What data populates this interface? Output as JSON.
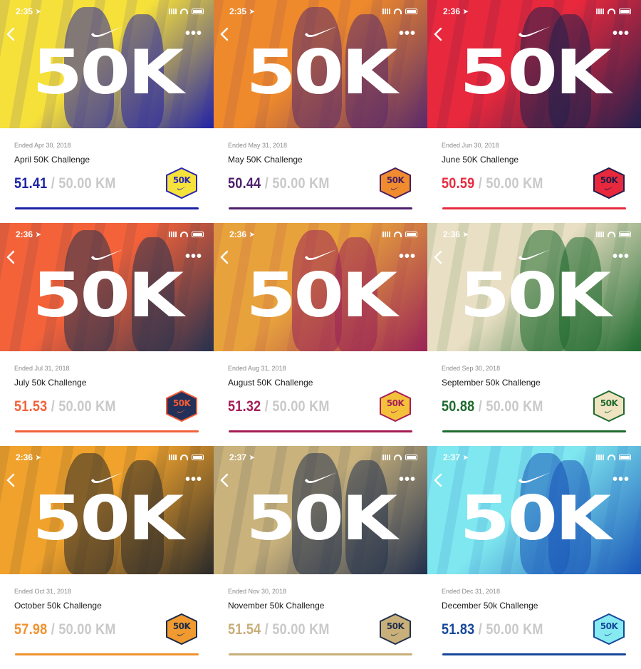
{
  "status": {
    "more_label": "•••"
  },
  "hero_title": "50K",
  "badge_text": "50K",
  "cards": [
    {
      "time": "2:35",
      "ended": "Ended Apr 30, 2018",
      "title": "April 50K Challenge",
      "distance": "51.41",
      "goal": " / 50.00 KM",
      "accent": "#1b22a3",
      "hero_color": "#f6e03a",
      "hero_dark": "#2323a5",
      "badge_fill": "#f5e23a",
      "badge_text_color": "#2a25b5"
    },
    {
      "time": "2:35",
      "ended": "Ended May 31, 2018",
      "title": "May 50K Challenge",
      "distance": "50.44",
      "goal": " / 50.00 KM",
      "accent": "#4e1f6c",
      "hero_color": "#ef8a2c",
      "hero_dark": "#5a2a6a",
      "badge_fill": "#f08c2e",
      "badge_text_color": "#4a1f60"
    },
    {
      "time": "2:36",
      "ended": "Ended Jun 30, 2018",
      "title": "June 50K Challenge",
      "distance": "50.59",
      "goal": " / 50.00 KM",
      "accent": "#e62b3e",
      "hero_color": "#e8283c",
      "hero_dark": "#23204d",
      "badge_fill": "#e8283c",
      "badge_text_color": "#1e1e4a"
    },
    {
      "time": "2:36",
      "ended": "Ended Jul 31, 2018",
      "title": "July 50k Challenge",
      "distance": "51.53",
      "goal": " / 50.00 KM",
      "accent": "#f2613a",
      "hero_color": "#f4623a",
      "hero_dark": "#27314e",
      "badge_fill": "#23305a",
      "badge_text_color": "#f45b34"
    },
    {
      "time": "2:36",
      "ended": "Ended Aug 31, 2018",
      "title": "August 50K Challenge",
      "distance": "51.32",
      "goal": " / 50.00 KM",
      "accent": "#a51d56",
      "hero_color": "#e8a23c",
      "hero_dark": "#9a2456",
      "badge_fill": "#f3c23a",
      "badge_text_color": "#a81f58"
    },
    {
      "time": "2:36",
      "ended": "Ended Sep 30, 2018",
      "title": "September 50k Challenge",
      "distance": "50.88",
      "goal": " / 50.00 KM",
      "accent": "#1e6b2d",
      "hero_color": "#e9dfc4",
      "hero_dark": "#1f6a2e",
      "badge_fill": "#efe3c2",
      "badge_text_color": "#1f6a2e"
    },
    {
      "time": "2:36",
      "ended": "Ended Oct 31, 2018",
      "title": "October 50k Challenge",
      "distance": "57.98",
      "goal": " / 50.00 KM",
      "accent": "#f0922e",
      "hero_color": "#f0a22c",
      "hero_dark": "#2a2a2a",
      "badge_fill": "#f09a30",
      "badge_text_color": "#1c2a48"
    },
    {
      "time": "2:37",
      "ended": "Ended Nov 30, 2018",
      "title": "November 50k Challenge",
      "distance": "51.54",
      "goal": " / 50.00 KM",
      "accent": "#c8ae78",
      "hero_color": "#c9b27c",
      "hero_dark": "#23314d",
      "badge_fill": "#c9b07a",
      "badge_text_color": "#23314d"
    },
    {
      "time": "2:37",
      "ended": "Ended Dec 31, 2018",
      "title": "December 50k Challenge",
      "distance": "51.83",
      "goal": " / 50.00 KM",
      "accent": "#16479a",
      "hero_color": "#7fe7ef",
      "hero_dark": "#1a56b8",
      "badge_fill": "#86eaf0",
      "badge_text_color": "#16479a"
    }
  ]
}
